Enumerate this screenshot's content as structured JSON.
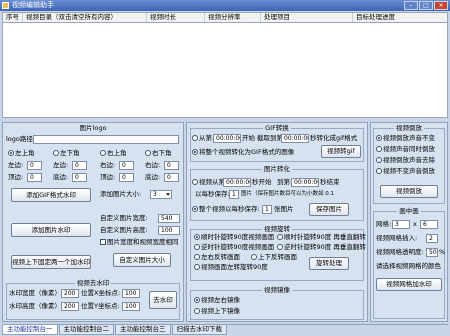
{
  "window": {
    "title": "视频编辑助手",
    "min": "–",
    "max": "□",
    "close": "×"
  },
  "grid": {
    "columns": [
      "序号",
      "视频目录（双击清空所有内容）",
      "视频时长",
      "视频分辨率",
      "处理项目",
      "目标处理进度"
    ]
  },
  "logo": {
    "title": "图片logo",
    "path_label": "logo路径:",
    "positions": [
      "左上角",
      "左下角",
      "右上角",
      "右下角"
    ],
    "margin_left": "左边:",
    "margin_top": "顶边:",
    "margin_bottom": "底边:",
    "margin_right": "右边:",
    "margin_value": "0",
    "add_gif_btn": "添加GIF格式水印",
    "add_image_label": "添加图片大小:",
    "add_image_value": "3",
    "add_pic_btn": "添加图片水印",
    "custom_width_label": "自定义图片宽度:",
    "custom_width_value": "540",
    "custom_height_label": "自定义图片高度:",
    "custom_height_value": "100",
    "keep_ratio_label": "图片宽度和视频宽度相同",
    "move_btn": "视频上下固定两一个加水印",
    "custom_size_btn": "自定义图片大小"
  },
  "watermark": {
    "title": "视频去水印",
    "width_label": "水印宽度（像素）:",
    "width_value": "200",
    "height_label": "水印高度（像素）:",
    "height_value": "200",
    "x_label": "位置X坐标点:",
    "x_value": "100",
    "y_label": "位置Y坐标点:",
    "y_value": "100",
    "remove_btn": "去水印"
  },
  "gif": {
    "title": "GIF转换",
    "from_label": "从第:",
    "start_time": "00:00:00",
    "start_suffix": "开始",
    "cut_label": "截取到第:",
    "end_time": "00:00:00",
    "end_suffix": "秒转化成gif格式",
    "convert_label": "将整个视频转化为GIF格式的图像",
    "btn": "视频转gif"
  },
  "pic": {
    "title": "图片转化",
    "from_label": "视频从第:",
    "t1": "00:00:00",
    "t1_suffix": "秒开始",
    "to_label": "到第:",
    "t2": "00:00:00",
    "t2_suffix": "秒结束",
    "each_label": "以每秒保存:",
    "each_value": "1",
    "each_suffix": "图片（保存图片数目可以为小数如 0.1",
    "whole_label": "整个视频以每秒保存:",
    "whole_value": "1",
    "whole_suffix": "张图片",
    "btn": "保存图片"
  },
  "rotate": {
    "title": "视频旋转",
    "options": [
      "顺时针旋转90度视频画面",
      "逆时针旋转90度视频画面",
      "顺时针旋转90度 再垂直翻转",
      "逆时针旋转90度 再垂直翻转",
      "左右反转画面",
      "上下反转画面",
      "视频画面左转旋转90度"
    ],
    "btn": "旋转处理"
  },
  "mirror": {
    "title": "视频镜像",
    "options": [
      "视频左右镜像",
      "视频上下镜像"
    ]
  },
  "reverse": {
    "title": "视频倒放",
    "options": [
      "视频倒放声音不变",
      "视频声音同时倒放",
      "视频倒放声音去除",
      "视频不变声音倒放"
    ],
    "btn": "视频倒放"
  },
  "grid_layout": {
    "title": "画中画",
    "grid_label": "网格:",
    "cols": "3",
    "x_sep": "x",
    "rows": "6",
    "count_label": "视频网格插入:",
    "count_value": "2",
    "alpha_label": "视频网格透明度:",
    "alpha_value": "50",
    "alpha_unit": "%",
    "pick_label": "请选择视频网格的颜色",
    "btn": "视频网格加水印"
  },
  "tabs": [
    "主功能控制台一",
    "主功能控制台二",
    "主功能控制台三",
    "扫描去水印下载"
  ]
}
